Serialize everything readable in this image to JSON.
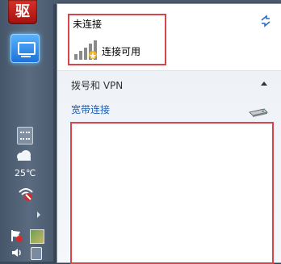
{
  "taskbar": {
    "app1_label": "驱",
    "temperature": "25℃"
  },
  "network_panel": {
    "status_title": "未连接",
    "availability_label": "连接可用",
    "group_header": "拨号和 VPN",
    "connection_name": "宽带连接"
  },
  "colors": {
    "highlight_border": "#d7454a",
    "link": "#1a5fb4",
    "taskbar": "#5a6b80"
  }
}
